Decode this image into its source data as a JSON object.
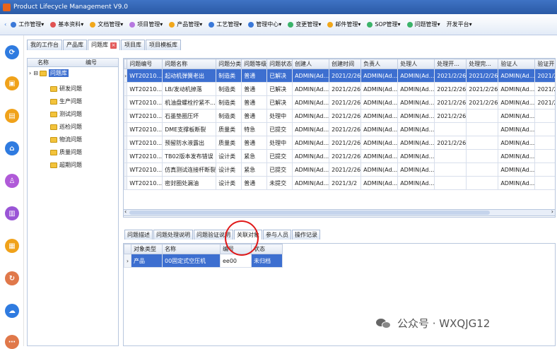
{
  "window": {
    "title": "Product Lifecycle Management V9.0"
  },
  "menu": [
    {
      "label": "工作管理",
      "color": "#3a78d8"
    },
    {
      "label": "基本资料",
      "color": "#e05252"
    },
    {
      "label": "文档管理",
      "color": "#f1a71b"
    },
    {
      "label": "项目管理",
      "color": "#b678e0"
    },
    {
      "label": "产品管理",
      "color": "#f1a71b"
    },
    {
      "label": "工艺管理",
      "color": "#3a78d8"
    },
    {
      "label": "管理中心",
      "color": "#3a78d8"
    },
    {
      "label": "变更管理",
      "color": "#3bb36a"
    },
    {
      "label": "邮件管理",
      "color": "#f1a71b"
    },
    {
      "label": "SOP管理",
      "color": "#3bb36a"
    },
    {
      "label": "问题管理",
      "color": "#3bb36a"
    },
    {
      "label": "开发平台",
      "color": "#ffffff"
    }
  ],
  "sidebar_icons": [
    {
      "icon": "refresh-icon",
      "color": "#2f7be0"
    },
    {
      "icon": "lock-icon",
      "color": "#f0a21a"
    },
    {
      "icon": "document-icon",
      "color": "#f0a21a"
    },
    {
      "icon": "home-icon",
      "color": "#2f7be0"
    },
    {
      "icon": "user-icon",
      "color": "#b05ad8"
    },
    {
      "icon": "report-icon",
      "color": "#9a55d6"
    },
    {
      "icon": "file-icon",
      "color": "#f0a21a"
    },
    {
      "icon": "cycle-icon",
      "color": "#e0784a"
    },
    {
      "icon": "cloud-icon",
      "color": "#2f7be0"
    },
    {
      "icon": "more-icon",
      "color": "#e0784a"
    }
  ],
  "tabs": [
    "我的工作台",
    "产品库",
    "问题库",
    "项目库",
    "项目模板库"
  ],
  "active_tab": "问题库",
  "tree": {
    "headers": {
      "name": "名称",
      "code": "编号"
    },
    "root": "问题库",
    "children": [
      "研发问题",
      "生产问题",
      "测试问题",
      "巡检问题",
      "物流问题",
      "质量问题",
      "超期问题"
    ]
  },
  "grid": {
    "columns": [
      "问题编号",
      "问题名称",
      "问题分类",
      "问题等级",
      "问题状态",
      "创建人",
      "创建时间",
      "负责人",
      "处理人",
      "处理开...",
      "处理完...",
      "验证人",
      "验证开..."
    ],
    "rows": [
      [
        "WT20210...",
        "起动机弹簧老出",
        "制造类",
        "普通",
        "已解决",
        "ADMIN(Ad...",
        "2021/2/26",
        "ADMIN(Ad...",
        "ADMIN(Ad...",
        "2021/2/26",
        "2021/2/26",
        "ADMIN(Ad...",
        "2021/2/26"
      ],
      [
        "WT20210...",
        "LB/发动机掉落",
        "制造类",
        "普通",
        "已解决",
        "ADMIN(Ad...",
        "2021/2/26",
        "ADMIN(Ad...",
        "ADMIN(Ad...",
        "2021/2/26",
        "2021/2/26",
        "ADMIN(Ad...",
        "2021/2/26"
      ],
      [
        "WT20210...",
        "机油盘螺栓拧紧不...",
        "制造类",
        "普通",
        "已解决",
        "ADMIN(Ad...",
        "2021/2/26",
        "ADMIN(Ad...",
        "ADMIN(Ad...",
        "2021/2/26",
        "2021/2/26",
        "ADMIN(Ad...",
        "2021/2/26"
      ],
      [
        "WT20210...",
        "石墨垫圈压坏",
        "制造类",
        "普通",
        "处理中",
        "ADMIN(Ad...",
        "2021/2/26",
        "ADMIN(Ad...",
        "ADMIN(Ad...",
        "2021/2/26",
        "",
        "ADMIN(Ad...",
        ""
      ],
      [
        "WT20210...",
        "DME支撑板断裂",
        "质量类",
        "特急",
        "已提交",
        "ADMIN(Ad...",
        "2021/2/26",
        "ADMIN(Ad...",
        "ADMIN(Ad...",
        "",
        "",
        "ADMIN(Ad...",
        ""
      ],
      [
        "WT20210...",
        "预留防水液露出",
        "质量类",
        "普通",
        "处理中",
        "ADMIN(Ad...",
        "2021/2/26",
        "ADMIN(Ad...",
        "ADMIN(Ad...",
        "2021/2/26",
        "",
        "ADMIN(Ad...",
        ""
      ],
      [
        "WT20210...",
        "TB02版本发布错误",
        "设计类",
        "紧急",
        "已提交",
        "ADMIN(Ad...",
        "2021/2/26",
        "ADMIN(Ad...",
        "ADMIN(Ad...",
        "",
        "",
        "ADMIN(Ad...",
        ""
      ],
      [
        "WT20210...",
        "仿真测试连接杆断裂",
        "设计类",
        "紧急",
        "已提交",
        "ADMIN(Ad...",
        "2021/2/26",
        "ADMIN(Ad...",
        "ADMIN(Ad...",
        "",
        "",
        "ADMIN(Ad...",
        ""
      ],
      [
        "WT20210...",
        "密封圈处漏油",
        "设计类",
        "普通",
        "未提交",
        "ADMIN(Ad...",
        "2021/3/2",
        "ADMIN(Ad...",
        "ADMIN(Ad...",
        "",
        "",
        "ADMIN(Ad...",
        ""
      ]
    ]
  },
  "bottom_tabs": [
    "问题描述",
    "问题处理说明",
    "问题验证说明",
    "关联对象",
    "参与人员",
    "操作记录"
  ],
  "bottom_active_tab": "关联对象",
  "bottom_grid": {
    "columns": [
      "对象类型",
      "名称",
      "编号",
      "状态"
    ],
    "rows": [
      [
        "产品",
        "00固定式空压机",
        "ee00",
        "未归档"
      ]
    ]
  },
  "watermark": {
    "text": "公众号 · WXQJG12"
  }
}
